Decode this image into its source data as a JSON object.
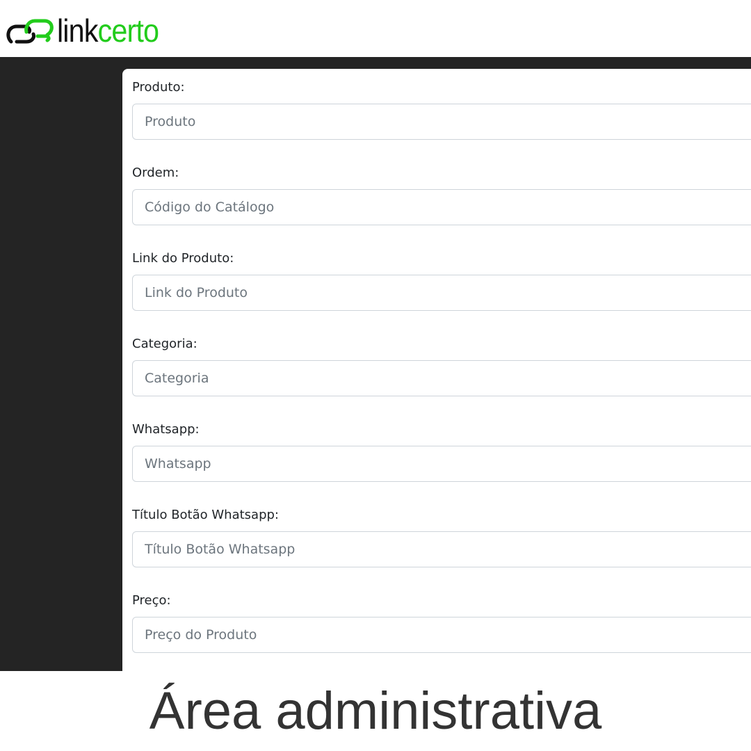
{
  "brand": {
    "logo_part1": "link",
    "logo_part2": "certo",
    "colors": {
      "accent_green": "#22cc1c",
      "logo_dark": "#111111",
      "dark_background": "#242424"
    },
    "icon": "chain-link-icon"
  },
  "form": {
    "fields": [
      {
        "label": "Produto:",
        "placeholder": "Produto",
        "value": ""
      },
      {
        "label": "Ordem:",
        "placeholder": "Código do Catálogo",
        "value": ""
      },
      {
        "label": "Link do Produto:",
        "placeholder": "Link do Produto",
        "value": ""
      },
      {
        "label": "Categoria:",
        "placeholder": "Categoria",
        "value": ""
      },
      {
        "label": "Whatsapp:",
        "placeholder": "Whatsapp",
        "value": ""
      },
      {
        "label": "Título Botão Whatsapp:",
        "placeholder": "Título Botão Whatsapp",
        "value": ""
      },
      {
        "label": "Preço:",
        "placeholder": "Preço do Produto",
        "value": ""
      }
    ]
  },
  "caption": "Área administrativa"
}
